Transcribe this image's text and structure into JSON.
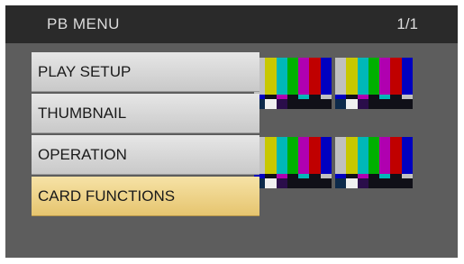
{
  "header": {
    "title": "PB MENU",
    "page_indicator": "1/1"
  },
  "menu": {
    "items": [
      {
        "label": "PLAY SETUP"
      },
      {
        "label": "THUMBNAIL"
      },
      {
        "label": "OPERATION"
      },
      {
        "label": "CARD FUNCTIONS"
      }
    ],
    "selected_index": 3
  },
  "thumbnails": {
    "count": 4
  },
  "colors": {
    "screen_bg": "#5d5d5d",
    "header_bg": "#2a2a2a",
    "item_bg": "#d6d6d6",
    "item_selected_bg": "#f0d68a",
    "bars": [
      "#c0c0c0",
      "#c8c800",
      "#00b8b8",
      "#00b000",
      "#b000b0",
      "#c00000",
      "#0000c0"
    ]
  }
}
